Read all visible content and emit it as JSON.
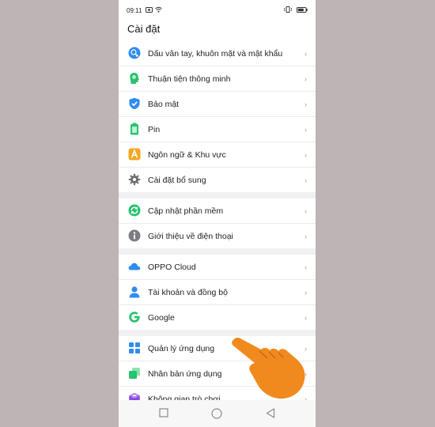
{
  "status": {
    "time": "09:11"
  },
  "header": {
    "title": "Cài đặt"
  },
  "groups": [
    {
      "items": [
        {
          "label": "Dấu vân tay, khuôn mặt và mật khẩu",
          "icon": "fingerprint-icon"
        },
        {
          "label": "Thuận tiện thông minh",
          "icon": "smart-head-icon"
        },
        {
          "label": "Bảo mật",
          "icon": "shield-icon"
        },
        {
          "label": "Pin",
          "icon": "battery-icon"
        },
        {
          "label": "Ngôn ngữ & Khu vực",
          "icon": "language-icon"
        },
        {
          "label": "Cài đặt bổ sung",
          "icon": "gear-icon"
        }
      ]
    },
    {
      "items": [
        {
          "label": "Cập nhật phần mềm",
          "icon": "update-icon"
        },
        {
          "label": "Giới thiệu về điện thoại",
          "icon": "info-icon"
        }
      ]
    },
    {
      "items": [
        {
          "label": "OPPO Cloud",
          "icon": "cloud-icon"
        },
        {
          "label": "Tài khoản và đồng bộ",
          "icon": "person-icon"
        },
        {
          "label": "Google",
          "icon": "google-icon"
        }
      ]
    },
    {
      "items": [
        {
          "label": "Quản lý ứng dụng",
          "icon": "apps-grid-icon"
        },
        {
          "label": "Nhân bản ứng dụng",
          "icon": "clone-icon"
        },
        {
          "label": "Không gian trò chơi",
          "icon": "game-cube-icon"
        }
      ]
    }
  ],
  "chevron": "›",
  "colors": {
    "accent_blue": "#2f8cf0",
    "accent_green": "#27c36f",
    "orange": "#f08a1e",
    "purple": "#8a4ce0"
  }
}
